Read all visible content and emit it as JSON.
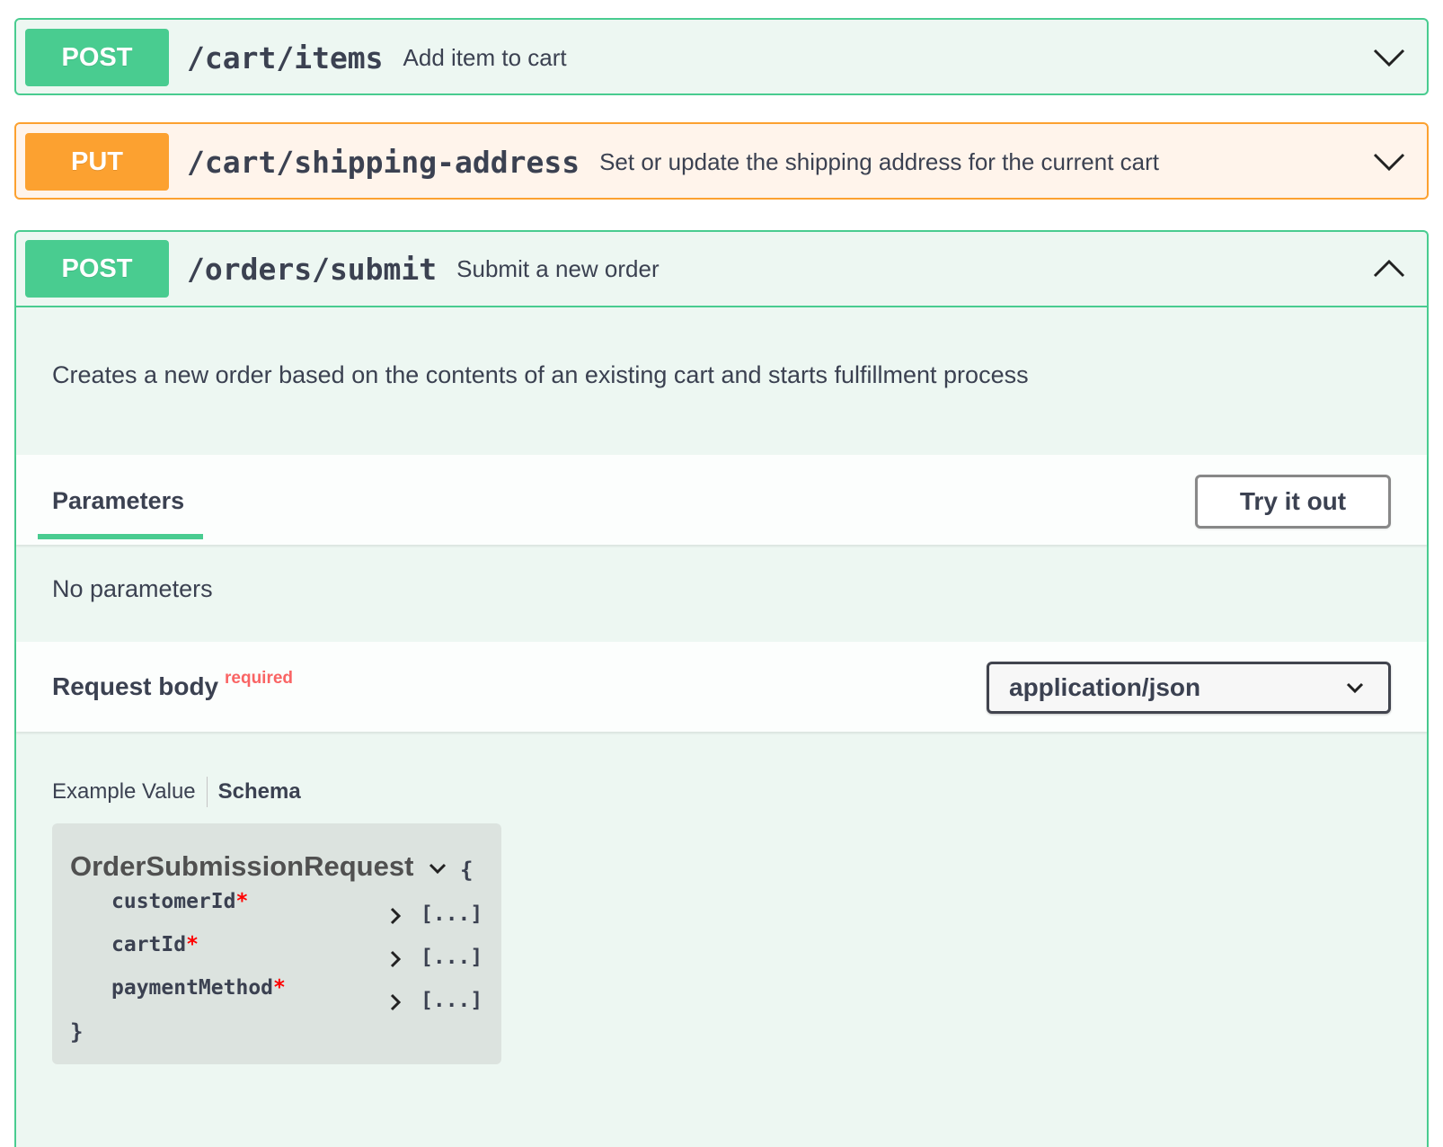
{
  "operations": [
    {
      "method": "POST",
      "path": "/cart/items",
      "summary": "Add item to cart",
      "expanded": false
    },
    {
      "method": "PUT",
      "path": "/cart/shipping-address",
      "summary": "Set or update the shipping address for the current cart",
      "expanded": false
    },
    {
      "method": "POST",
      "path": "/orders/submit",
      "summary": "Submit a new order",
      "expanded": true,
      "description": "Creates a new order based on the contents of an existing cart and starts fulfillment process",
      "parameters_tab": "Parameters",
      "try_button": "Try it out",
      "no_params": "No parameters",
      "request_body": {
        "title": "Request body",
        "required_label": "required",
        "content_type": "application/json",
        "tab_example": "Example Value",
        "tab_schema": "Schema",
        "model": {
          "name": "OrderSubmissionRequest",
          "open_brace": "{",
          "close_brace": "}",
          "properties": [
            {
              "name": "customerId",
              "required_mark": "*",
              "value": "[...]"
            },
            {
              "name": "cartId",
              "required_mark": "*",
              "value": "[...]"
            },
            {
              "name": "paymentMethod",
              "required_mark": "*",
              "value": "[...]"
            }
          ]
        }
      }
    }
  ],
  "colors": {
    "post": "#49cc90",
    "put": "#fca130",
    "post_bg": "#edf7f2",
    "put_bg": "#fff4eb",
    "required": "#f93e3e"
  },
  "icons": {
    "collapsed": "chevron-down-icon",
    "expanded": "chevron-up-icon",
    "property_toggle": "chevron-right-icon"
  }
}
